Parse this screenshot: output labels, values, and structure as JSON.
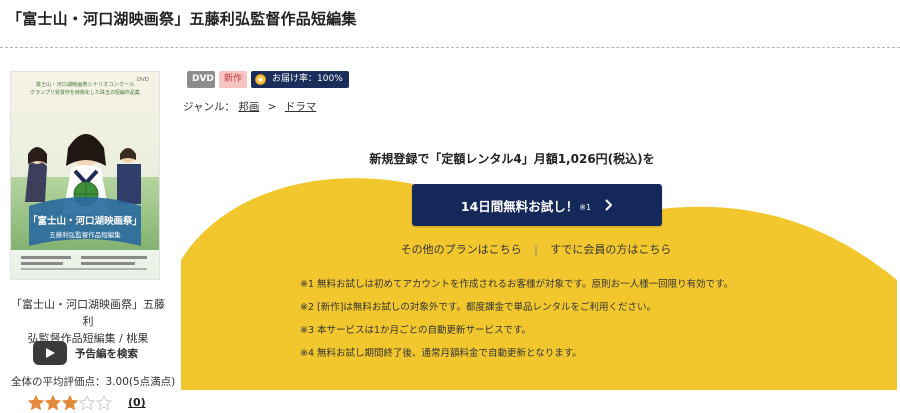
{
  "page": {
    "title": "「富士山・河口湖映画祭」五藤利弘監督作品短編集"
  },
  "item": {
    "title_line1": "「富士山・河口湖映画祭」五藤利",
    "title_line2": "弘監督作品短編集 / 桃果",
    "trailer_label": "予告編を検索",
    "rating_text": "全体の平均評価点：3.00(5点満点)",
    "rating_value": 3,
    "rating_max": 5,
    "review_count": "(0)"
  },
  "cover": {
    "top_text_1": "富士山・河口湖映画祭シナリオコンクール",
    "top_text_2": "グランプリ受賞作を映像化した珠玉の短編作品集",
    "label_dvd": "DVD",
    "title_line1": "「富士山・河口湖映画祭」",
    "title_line2": "五藤利弘監督作品短編集"
  },
  "badges": {
    "format": "DVD",
    "new": "新作",
    "delivery": "お届け率：100%"
  },
  "genre": {
    "label": "ジャンル：",
    "crumb1": "邦画",
    "separator": ">",
    "crumb2": "ドラマ"
  },
  "offer": {
    "headline": "新規登録で「定額レンタル4」月額1,026円(税込)を",
    "cta_label": "14日間無料お試し！",
    "cta_note": "※1",
    "link_other_plans": "その他のプランはこちら",
    "link_divider": "|",
    "link_member": "すでに会員の方はこちら"
  },
  "notes": [
    "※1 無料お試しは初めてアカウントを作成されるお客様が対象です。原則お一人様一回限り有効です。",
    "※2 [新作]は無料お試しの対象外です。都度課金で単品レンタルをご利用ください。",
    "※3 本サービスは1か月ごとの自動更新サービスです。",
    "※4 無料お試し期間終了後、通常月額料金で自動更新となります。"
  ],
  "colors": {
    "yellow_bg": "#f2c72e",
    "cta_bg": "#14285a",
    "badge_delivery_bg": "#1b2d5a",
    "badge_new_bg": "#f7c3c3",
    "star_fill": "#e58a3a",
    "star_empty": "#cfcfcf"
  }
}
